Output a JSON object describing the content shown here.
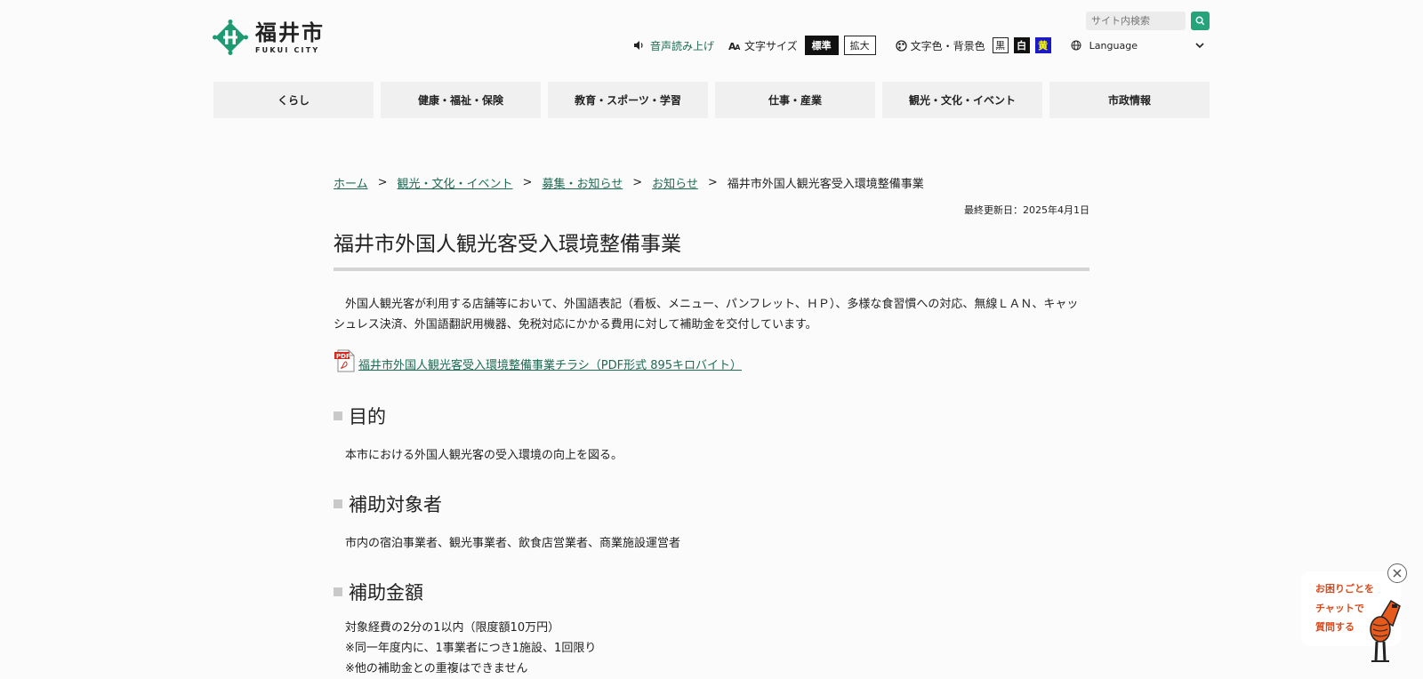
{
  "header": {
    "logo_jp": "福井市",
    "logo_en": "FUKUI CITY",
    "search_placeholder": "サイト内検索",
    "voice": "音声読み上げ",
    "text_size_label": "文字サイズ",
    "size_standard": "標準",
    "size_large": "拡大",
    "color_label": "文字色・背景色",
    "color_black": "黒",
    "color_white": "白",
    "color_yellow": "黄",
    "language": "Language",
    "colors": {
      "accent": "#27a37c",
      "link": "#1d6b54"
    }
  },
  "gnav": [
    "くらし",
    "健康・福祉・保険",
    "教育・スポーツ・学習",
    "仕事・産業",
    "観光・文化・イベント",
    "市政情報"
  ],
  "breadcrumb": {
    "items": [
      "ホーム",
      "観光・文化・イベント",
      "募集・お知らせ",
      "お知らせ"
    ],
    "current": "福井市外国人観光客受入環境整備事業",
    "separator": ">"
  },
  "page": {
    "updated": "最終更新日：2025年4月1日",
    "title": "福井市外国人観光客受入環境整備事業",
    "lead": "外国人観光客が利用する店舗等において、外国語表記（看板、メニュー、パンフレット、ＨＰ）、多様な食習慣への対応、無線ＬＡＮ、キャッシュレス決済、外国語翻訳用機器、免税対応にかかる費用に対して補助金を交付しています。",
    "pdf_link": "福井市外国人観光客受入環境整備事業チラシ（PDF形式 895キロバイト）",
    "sections": [
      {
        "heading": "目的",
        "body": "本市における外国人観光客の受入環境の向上を図る。"
      },
      {
        "heading": "補助対象者",
        "body": "市内の宿泊事業者、観光事業者、飲食店営業者、商業施設運営者"
      },
      {
        "heading": "補助金額",
        "lines": [
          "対象経費の2分の1以内（限度額10万円）",
          "※同一年度内に、1事業者につき1施設、1回限り",
          "※他の補助金との重複はできません"
        ]
      }
    ]
  },
  "chat": {
    "line1": "お困りごとを",
    "line2": "チャットで",
    "line3": "質問する"
  }
}
